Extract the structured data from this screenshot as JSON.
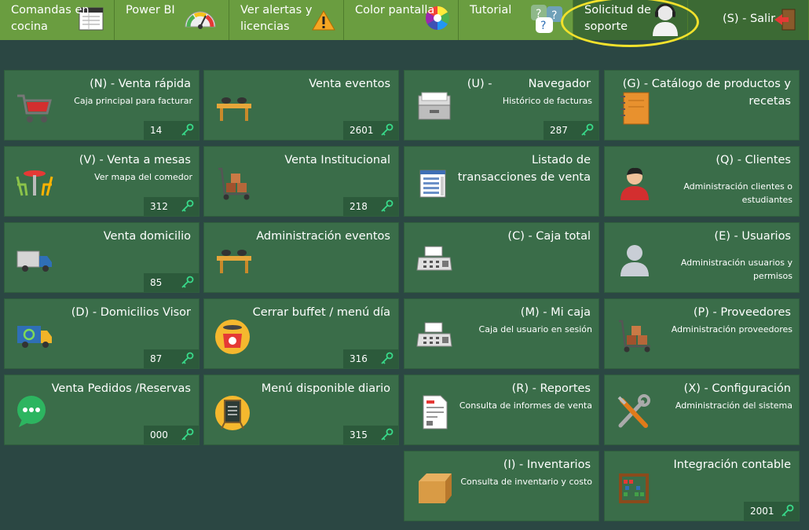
{
  "topbar": {
    "items": [
      {
        "label": "Comandas en\ncocina",
        "icon": "receipt-icon"
      },
      {
        "label": "Power BI",
        "icon": "gauge-icon"
      },
      {
        "label": "Ver alertas y\nlicencias",
        "icon": "warning-icon"
      },
      {
        "label": "Color pantalla",
        "icon": "color-wheel-icon"
      },
      {
        "label": "Tutorial",
        "icon": "help-bubbles-icon"
      },
      {
        "label": "Solicitud de\nsoporte",
        "icon": "support-agent-icon"
      },
      {
        "label": "(S) - Salir",
        "icon": "exit-door-icon"
      }
    ]
  },
  "tiles": {
    "venta_rapida": {
      "title": "(N) - Venta rápida",
      "sub": "Caja principal para facturar",
      "badge": "14"
    },
    "venta_eventos": {
      "title": "Venta eventos",
      "badge": "2601"
    },
    "navegador": {
      "title": "(U) -          Navegador",
      "sub": "Histórico de facturas",
      "badge": "287"
    },
    "catalogo": {
      "title": "(G) -              Catálogo de productos y recetas"
    },
    "venta_mesas": {
      "title": "(V) - Venta a mesas",
      "sub": "Ver mapa del comedor",
      "badge": "312"
    },
    "venta_institucional": {
      "title": "Venta Institucional",
      "badge": "218"
    },
    "listado": {
      "title": "Listado de transacciones de venta"
    },
    "clientes": {
      "title": "(Q) - Clientes",
      "sub": "Administración clientes o estudiantes"
    },
    "venta_domicilio": {
      "title": "Venta domicilio",
      "badge": "85"
    },
    "admin_eventos": {
      "title": "Administración eventos"
    },
    "caja_total": {
      "title": "(C) - Caja total"
    },
    "usuarios": {
      "title": "(E) - Usuarios",
      "sub": "Administración usuarios y permisos"
    },
    "domicilios_visor": {
      "title": "(D) - Domicilios Visor",
      "badge": "87"
    },
    "cerrar_buffet": {
      "title": "Cerrar buffet / menú día",
      "badge": "316"
    },
    "mi_caja": {
      "title": "(M) - Mi caja",
      "sub": "Caja del usuario en sesión"
    },
    "proveedores": {
      "title": "(P) - Proveedores",
      "sub": "Administración proveedores"
    },
    "pedidos_reservas": {
      "title": "Venta Pedidos /Reservas",
      "badge": "000"
    },
    "menu_diario": {
      "title": "Menú disponible diario",
      "badge": "315"
    },
    "reportes": {
      "title": "(R) - Reportes",
      "sub": "Consulta de informes de venta"
    },
    "configuracion": {
      "title": "(X) - Configuración",
      "sub": "Administración del sistema"
    },
    "inventarios": {
      "title": "(I) - Inventarios",
      "sub": "Consulta de inventario y costo"
    },
    "integracion": {
      "title": "Integración contable",
      "badge": "2001"
    }
  },
  "colors": {
    "background": "#2b4743",
    "topbar_green": "#6a9d40",
    "tile": "#3a6d49",
    "badge": "#2c5a3b",
    "highlight_ring": "#f2e12c"
  }
}
